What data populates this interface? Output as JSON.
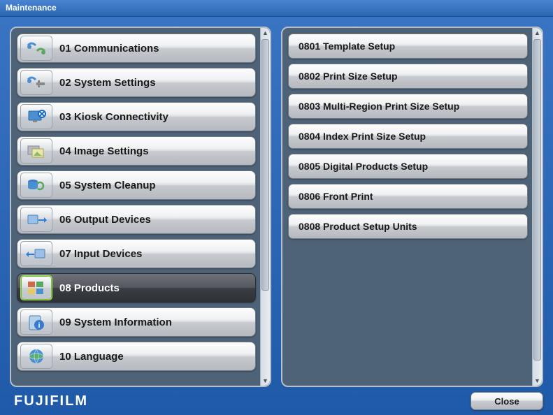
{
  "window": {
    "title": "Maintenance"
  },
  "brand": "FUJIFILM",
  "close_label": "Close",
  "main_menu": [
    {
      "id": "01",
      "label": "01 Communications",
      "icon": "communications-icon",
      "selected": false
    },
    {
      "id": "02",
      "label": "02 System Settings",
      "icon": "system-settings-icon",
      "selected": false
    },
    {
      "id": "03",
      "label": "03 Kiosk Connectivity",
      "icon": "kiosk-connectivity-icon",
      "selected": false
    },
    {
      "id": "04",
      "label": "04 Image Settings",
      "icon": "image-settings-icon",
      "selected": false
    },
    {
      "id": "05",
      "label": "05 System Cleanup",
      "icon": "system-cleanup-icon",
      "selected": false
    },
    {
      "id": "06",
      "label": "06 Output Devices",
      "icon": "output-devices-icon",
      "selected": false
    },
    {
      "id": "07",
      "label": "07 Input Devices",
      "icon": "input-devices-icon",
      "selected": false
    },
    {
      "id": "08",
      "label": "08 Products",
      "icon": "products-icon",
      "selected": true
    },
    {
      "id": "09",
      "label": "09 System Information",
      "icon": "system-information-icon",
      "selected": false
    },
    {
      "id": "10",
      "label": "10 Language",
      "icon": "language-icon",
      "selected": false
    }
  ],
  "sub_menu": [
    {
      "id": "0801",
      "label": "0801 Template Setup"
    },
    {
      "id": "0802",
      "label": "0802 Print Size Setup"
    },
    {
      "id": "0803",
      "label": "0803 Multi-Region Print Size Setup"
    },
    {
      "id": "0804",
      "label": "0804 Index Print Size Setup"
    },
    {
      "id": "0805",
      "label": "0805 Digital Products Setup"
    },
    {
      "id": "0806",
      "label": "0806 Front Print"
    },
    {
      "id": "0808",
      "label": "0808 Product Setup Units"
    }
  ]
}
